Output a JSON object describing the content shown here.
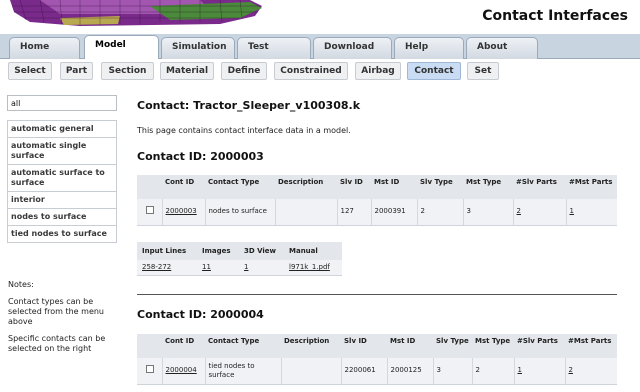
{
  "header": {
    "title": "Contact Interfaces"
  },
  "tabs": [
    {
      "label": "Home",
      "active": false
    },
    {
      "label": "Model",
      "active": true
    },
    {
      "label": "Simulation",
      "active": false
    },
    {
      "label": "Test",
      "active": false
    },
    {
      "label": "Download",
      "active": false
    },
    {
      "label": "Help",
      "active": false
    },
    {
      "label": "About",
      "active": false
    }
  ],
  "subtabs": [
    {
      "label": "Select",
      "active": false
    },
    {
      "label": "Part",
      "active": false
    },
    {
      "label": "Section",
      "active": false
    },
    {
      "label": "Material",
      "active": false
    },
    {
      "label": "Define",
      "active": false
    },
    {
      "label": "Constrained",
      "active": false
    },
    {
      "label": "Airbag",
      "active": false
    },
    {
      "label": "Contact",
      "active": true
    },
    {
      "label": "Set",
      "active": false
    }
  ],
  "sidebar": {
    "search_value": "all",
    "items": [
      "automatic general",
      "automatic single surface",
      "automatic surface to surface",
      "interior",
      "nodes to surface",
      "tied nodes to surface"
    ],
    "notes_title": "Notes:",
    "notes": [
      "Contact types can be selected from the menu above",
      "Specific contacts can be selected on the right"
    ]
  },
  "main": {
    "page_title": "Contact: Tractor_Sleeper_v100308.k",
    "intro": "This page contains contact interface data in a model.",
    "contacts": [
      {
        "heading": "Contact ID: 2000003",
        "columns": [
          "",
          "Cont ID",
          "Contact Type",
          "Description",
          "Slv ID",
          "Mst ID",
          "Slv Type",
          "Mst Type",
          "#Slv Parts",
          "#Mst Parts"
        ],
        "row": {
          "cont_id": "2000003",
          "contact_type": "nodes to surface",
          "description": "",
          "slv_id": "127",
          "mst_id": "2000391",
          "slv_type": "2",
          "mst_type": "3",
          "slv_parts": "2",
          "mst_parts": "1"
        },
        "info": {
          "columns": [
            "Input Lines",
            "Images",
            "3D View",
            "Manual"
          ],
          "values": [
            "258-272",
            "11",
            "1",
            "l971k_1.pdf"
          ]
        }
      },
      {
        "heading": "Contact ID: 2000004",
        "columns": [
          "",
          "Cont ID",
          "Contact Type",
          "Description",
          "Slv ID",
          "Mst ID",
          "Slv Type",
          "Mst Type",
          "#Slv Parts",
          "#Mst Parts"
        ],
        "row": {
          "cont_id": "2000004",
          "contact_type": "tied nodes to surface",
          "description": "",
          "slv_id": "2200061",
          "mst_id": "2000125",
          "slv_type": "3",
          "mst_type": "2",
          "slv_parts": "1",
          "mst_parts": "2"
        }
      }
    ]
  }
}
